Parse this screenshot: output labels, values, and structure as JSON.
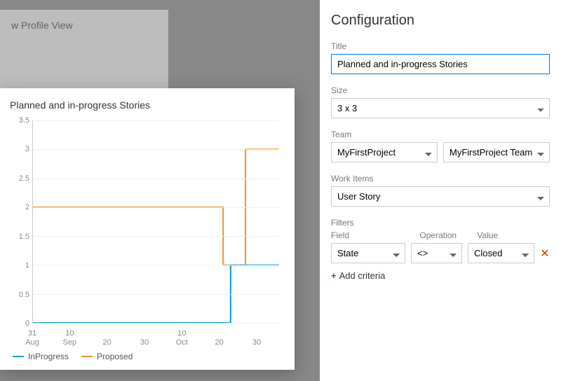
{
  "bg_card_title": "w Profile View",
  "chart": {
    "title": "Planned and in-progress Stories",
    "legend": {
      "inprogress": "InProgress",
      "proposed": "Proposed"
    },
    "colors": {
      "inprogress": "#00a2c7",
      "proposed": "#e6942e"
    },
    "y_ticks": [
      0,
      0.5,
      1,
      1.5,
      2,
      2.5,
      3,
      3.5
    ],
    "x_ticks": [
      {
        "idx": 0,
        "label": "31\nAug"
      },
      {
        "idx": 10,
        "label": "10\nSep"
      },
      {
        "idx": 20,
        "label": "20"
      },
      {
        "idx": 30,
        "label": "30"
      },
      {
        "idx": 40,
        "label": "10\nOct"
      },
      {
        "idx": 50,
        "label": "20"
      },
      {
        "idx": 60,
        "label": "30"
      }
    ]
  },
  "chart_data": {
    "type": "line",
    "title": "Planned and in-progress Stories",
    "xlabel": "",
    "ylabel": "",
    "x_range_days": [
      0,
      66
    ],
    "ylim": [
      0,
      3.5
    ],
    "series": [
      {
        "name": "inprogress",
        "points": [
          {
            "x": 0,
            "y": 0
          },
          {
            "x": 52,
            "y": 0
          },
          {
            "x": 53,
            "y": 1
          },
          {
            "x": 66,
            "y": 1
          }
        ]
      },
      {
        "name": "proposed",
        "points": [
          {
            "x": 0,
            "y": 2
          },
          {
            "x": 50,
            "y": 2
          },
          {
            "x": 51,
            "y": 1
          },
          {
            "x": 56,
            "y": 1
          },
          {
            "x": 57,
            "y": 3
          },
          {
            "x": 66,
            "y": 3
          }
        ]
      }
    ]
  },
  "config": {
    "heading": "Configuration",
    "labels": {
      "title": "Title",
      "size": "Size",
      "team": "Team",
      "work_items": "Work Items",
      "filters": "Filters",
      "field": "Field",
      "operation": "Operation",
      "value": "Value",
      "add": "Add criteria"
    },
    "title_value": "Planned and in-progress Stories",
    "size_value": "3 x 3",
    "team_project": "MyFirstProject",
    "team_name": "MyFirstProject Team",
    "work_items_value": "User Story",
    "filter": {
      "field": "State",
      "operation": "<>",
      "value": "Closed"
    }
  }
}
